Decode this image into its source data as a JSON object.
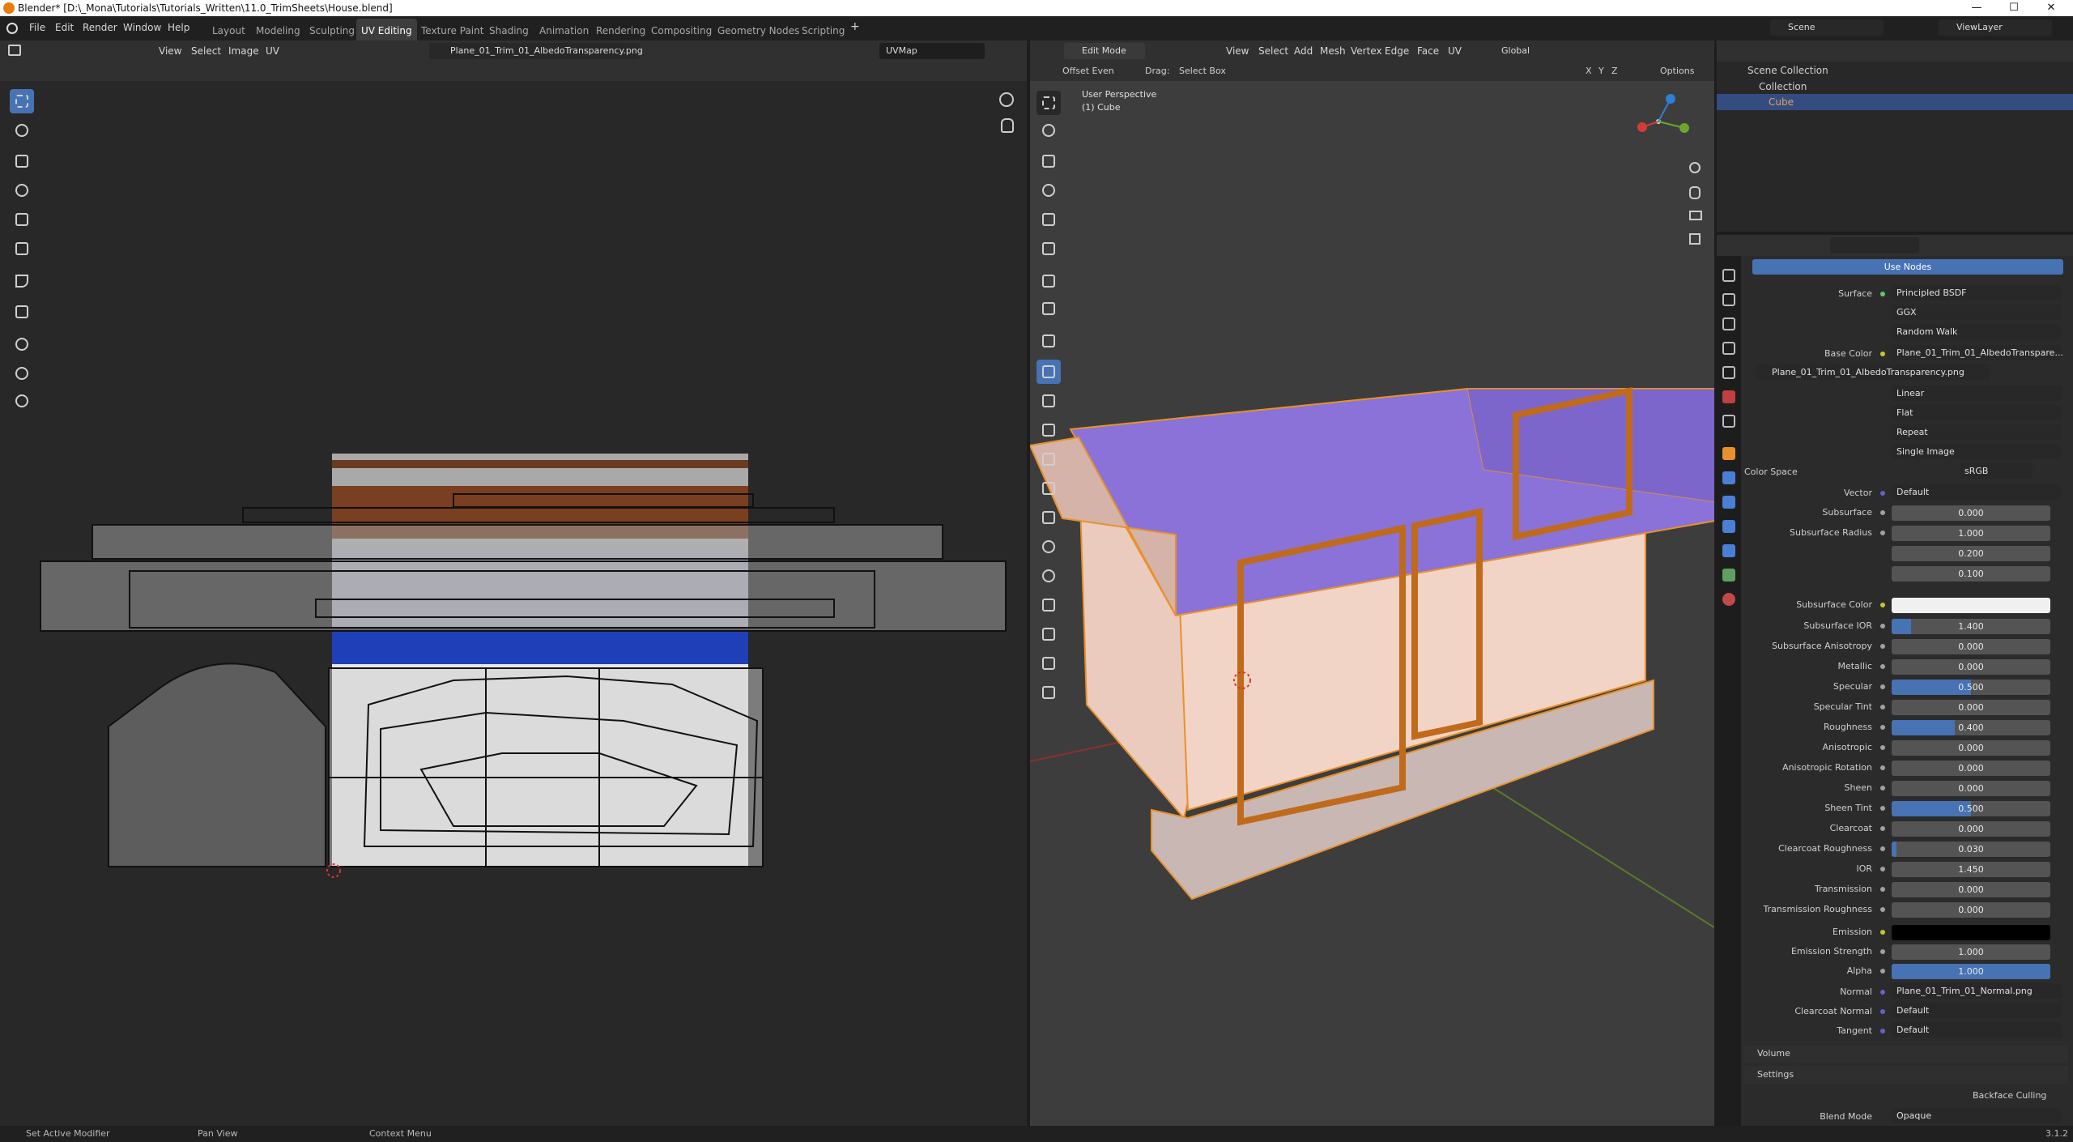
{
  "title": "Blender* [D:\\_Mona\\Tutorials\\Tutorials_Written\\11.0_TrimSheets\\House.blend]",
  "menu": [
    "File",
    "Edit",
    "Render",
    "Window",
    "Help"
  ],
  "workspaces": [
    "Layout",
    "Modeling",
    "Sculpting",
    "UV Editing",
    "Texture Paint",
    "Shading",
    "Animation",
    "Rendering",
    "Compositing",
    "Geometry Nodes",
    "Scripting"
  ],
  "scene_name": "Scene",
  "view_layer": "ViewLayer",
  "uv_editor": {
    "menus": [
      "View",
      "Select",
      "Image",
      "UV"
    ],
    "image_name": "Plane_01_Trim_01_AlbedoTransparency.png",
    "uv_map": "UVMap"
  },
  "viewport": {
    "mode": "Edit Mode",
    "menus": [
      "View",
      "Select",
      "Add",
      "Mesh",
      "Vertex",
      "Edge",
      "Face",
      "UV"
    ],
    "orientation": "Global",
    "offset_even": "Offset Even",
    "drag_label": "Drag:",
    "drag_value": "Select Box",
    "options": "Options",
    "axis": [
      "X",
      "Y",
      "Z"
    ],
    "overlay_title": "User Perspective",
    "overlay_object": "(1) Cube"
  },
  "outliner": {
    "scene_collection": "Scene Collection",
    "collection": "Collection",
    "cube": "Cube"
  },
  "properties": {
    "use_nodes": "Use Nodes",
    "surface_label": "Surface",
    "surface_value": "Principled BSDF",
    "distribution": "GGX",
    "subsurface_method": "Random Walk",
    "base_color_label": "Base Color",
    "base_color_value": "Plane_01_Trim_01_AlbedoTranspare...",
    "image_block": "Plane_01_Trim_01_AlbedoTransparency.png",
    "interpolation": "Linear",
    "projection": "Flat",
    "extension": "Repeat",
    "source": "Single Image",
    "color_space_label": "Color Space",
    "color_space_value": "sRGB",
    "vector_label": "Vector",
    "vector_value": "Default",
    "sliders": [
      {
        "label": "Subsurface",
        "value": "0.000",
        "fill": 0
      },
      {
        "label": "Subsurface Radius",
        "value": "1.000",
        "fill": 0
      },
      {
        "label": "",
        "value": "0.200",
        "fill": 0
      },
      {
        "label": "",
        "value": "0.100",
        "fill": 0
      }
    ],
    "subsurface_color_label": "Subsurface Color",
    "params": [
      {
        "label": "Subsurface IOR",
        "value": "1.400",
        "fill": 0.12
      },
      {
        "label": "Subsurface Anisotropy",
        "value": "0.000",
        "fill": 0
      },
      {
        "label": "Metallic",
        "value": "0.000",
        "fill": 0
      },
      {
        "label": "Specular",
        "value": "0.500",
        "fill": 0.5
      },
      {
        "label": "Specular Tint",
        "value": "0.000",
        "fill": 0
      },
      {
        "label": "Roughness",
        "value": "0.400",
        "fill": 0.4
      },
      {
        "label": "Anisotropic",
        "value": "0.000",
        "fill": 0
      },
      {
        "label": "Anisotropic Rotation",
        "value": "0.000",
        "fill": 0
      },
      {
        "label": "Sheen",
        "value": "0.000",
        "fill": 0
      },
      {
        "label": "Sheen Tint",
        "value": "0.500",
        "fill": 0.5
      },
      {
        "label": "Clearcoat",
        "value": "0.000",
        "fill": 0
      },
      {
        "label": "Clearcoat Roughness",
        "value": "0.030",
        "fill": 0.03
      },
      {
        "label": "IOR",
        "value": "1.450",
        "fill": 0
      },
      {
        "label": "Transmission",
        "value": "0.000",
        "fill": 0
      },
      {
        "label": "Transmission Roughness",
        "value": "0.000",
        "fill": 0
      }
    ],
    "emission_label": "Emission",
    "emission_strength_label": "Emission Strength",
    "emission_strength_value": "1.000",
    "alpha_label": "Alpha",
    "alpha_value": "1.000",
    "normal_label": "Normal",
    "normal_value": "Plane_01_Trim_01_Normal.png",
    "clearcoat_normal_label": "Clearcoat Normal",
    "clearcoat_normal_value": "Default",
    "tangent_label": "Tangent",
    "tangent_value": "Default",
    "volume": "Volume",
    "settings": "Settings",
    "backface_culling": "Backface Culling",
    "blend_mode_label": "Blend Mode",
    "blend_mode_value": "Opaque"
  },
  "status": {
    "left": "Set Active Modifier",
    "middle": "Pan View",
    "right": "Context Menu",
    "version": "3.1.2"
  },
  "colors": {
    "accent": "#4772b3",
    "edit_orange": "#e8912c",
    "roof_purple": "#8a72d8",
    "wall": "#f0d2c4"
  }
}
